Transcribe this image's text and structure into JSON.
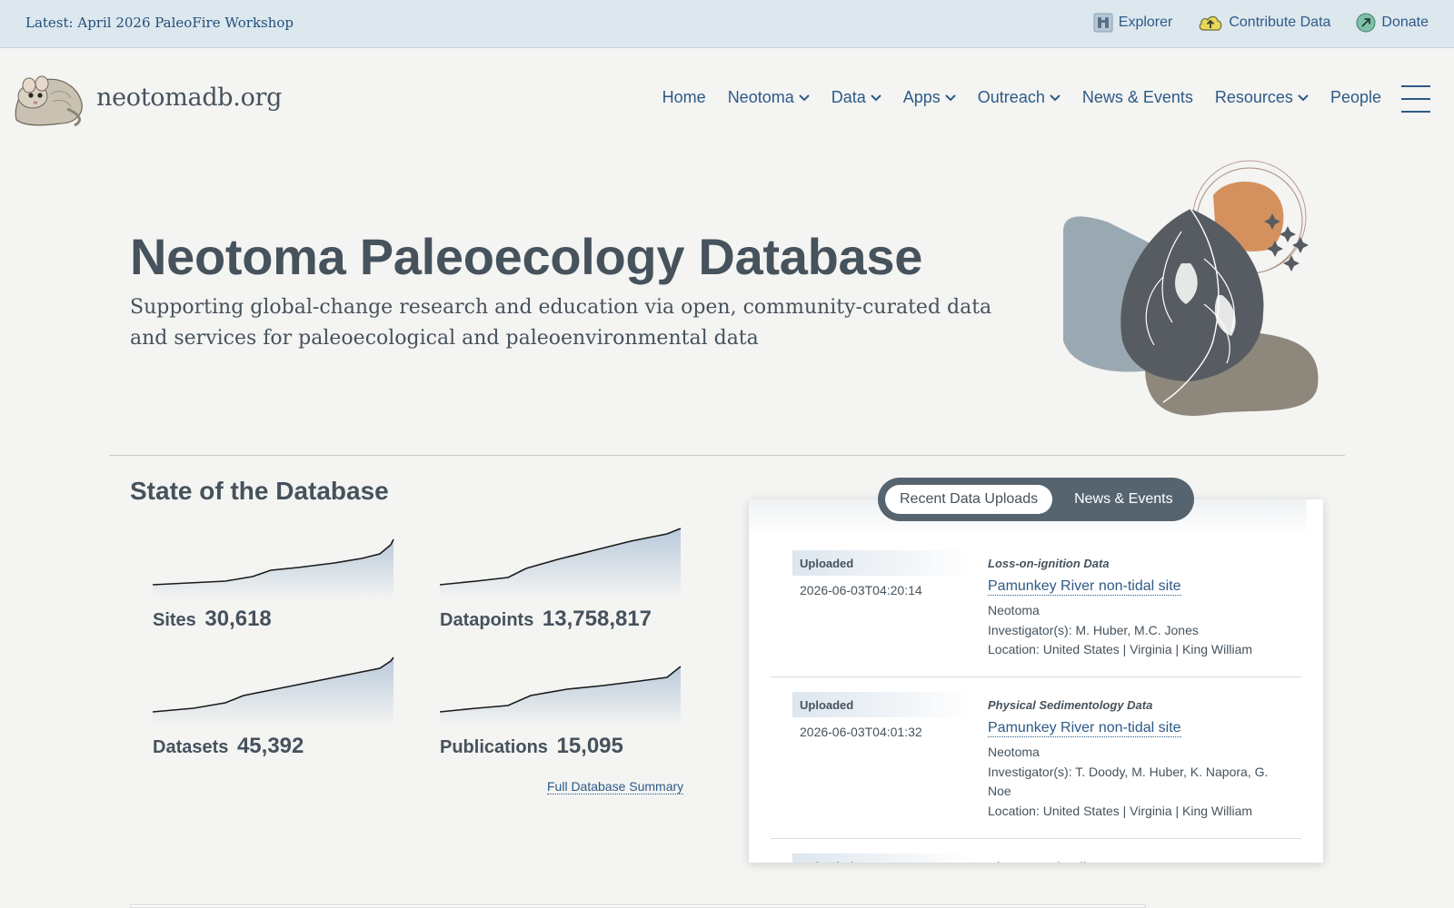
{
  "topbar": {
    "latest": "Latest: April 2026 PaleoFire Workshop",
    "links": [
      {
        "label": "Explorer",
        "icon": "binoculars-icon"
      },
      {
        "label": "Contribute Data",
        "icon": "cloud-upload-icon"
      },
      {
        "label": "Donate",
        "icon": "donate-arrow-icon"
      }
    ]
  },
  "header": {
    "brand": "neotomadb.org",
    "logo_icon": "woodrat-logo-icon",
    "nav": [
      {
        "label": "Home",
        "dropdown": false
      },
      {
        "label": "Neotoma",
        "dropdown": true
      },
      {
        "label": "Data",
        "dropdown": true
      },
      {
        "label": "Apps",
        "dropdown": true
      },
      {
        "label": "Outreach",
        "dropdown": true
      },
      {
        "label": "News & Events",
        "dropdown": false
      },
      {
        "label": "Resources",
        "dropdown": true
      },
      {
        "label": "People",
        "dropdown": false
      }
    ]
  },
  "hero": {
    "title": "Neotoma Paleoecology Database",
    "subtitle": "Supporting global-change research and education via open, community-curated data and services for paleoecological and paleoenvironmental data"
  },
  "state": {
    "title": "State of the Database",
    "stats": [
      {
        "label": "Sites",
        "value": "30,618"
      },
      {
        "label": "Datapoints",
        "value": "13,758,817"
      },
      {
        "label": "Datasets",
        "value": "45,392"
      },
      {
        "label": "Publications",
        "value": "15,095"
      }
    ],
    "summary_link": "Full Database Summary"
  },
  "panel": {
    "tabs": [
      {
        "label": "Recent Data Uploads",
        "active": true
      },
      {
        "label": "News & Events",
        "active": false
      }
    ],
    "uploads": [
      {
        "badge": "Uploaded",
        "time": "2026-06-03T04:20:14",
        "type": "Loss-on-ignition Data",
        "site": "Pamunkey River non-tidal site",
        "database": "Neotoma",
        "investigators": "Investigator(s): M. Huber, M.C. Jones",
        "location": "Location: United States | Virginia | King William"
      },
      {
        "badge": "Uploaded",
        "time": "2026-06-03T04:01:32",
        "type": "Physical Sedimentology Data",
        "site": "Pamunkey River non-tidal site",
        "database": "Neotoma",
        "investigators": "Investigator(s): T. Doody, M. Huber, K. Napora, G. Noe",
        "location": "Location: United States | Virginia | King William"
      }
    ],
    "partial_badge": "Uploaded",
    "partial_type": "Plant Macrofossil Data"
  },
  "colors": {
    "accent": "#2d5a87",
    "text": "#46525c",
    "topbar": "#dce7ee",
    "background": "#f4f4f2"
  }
}
